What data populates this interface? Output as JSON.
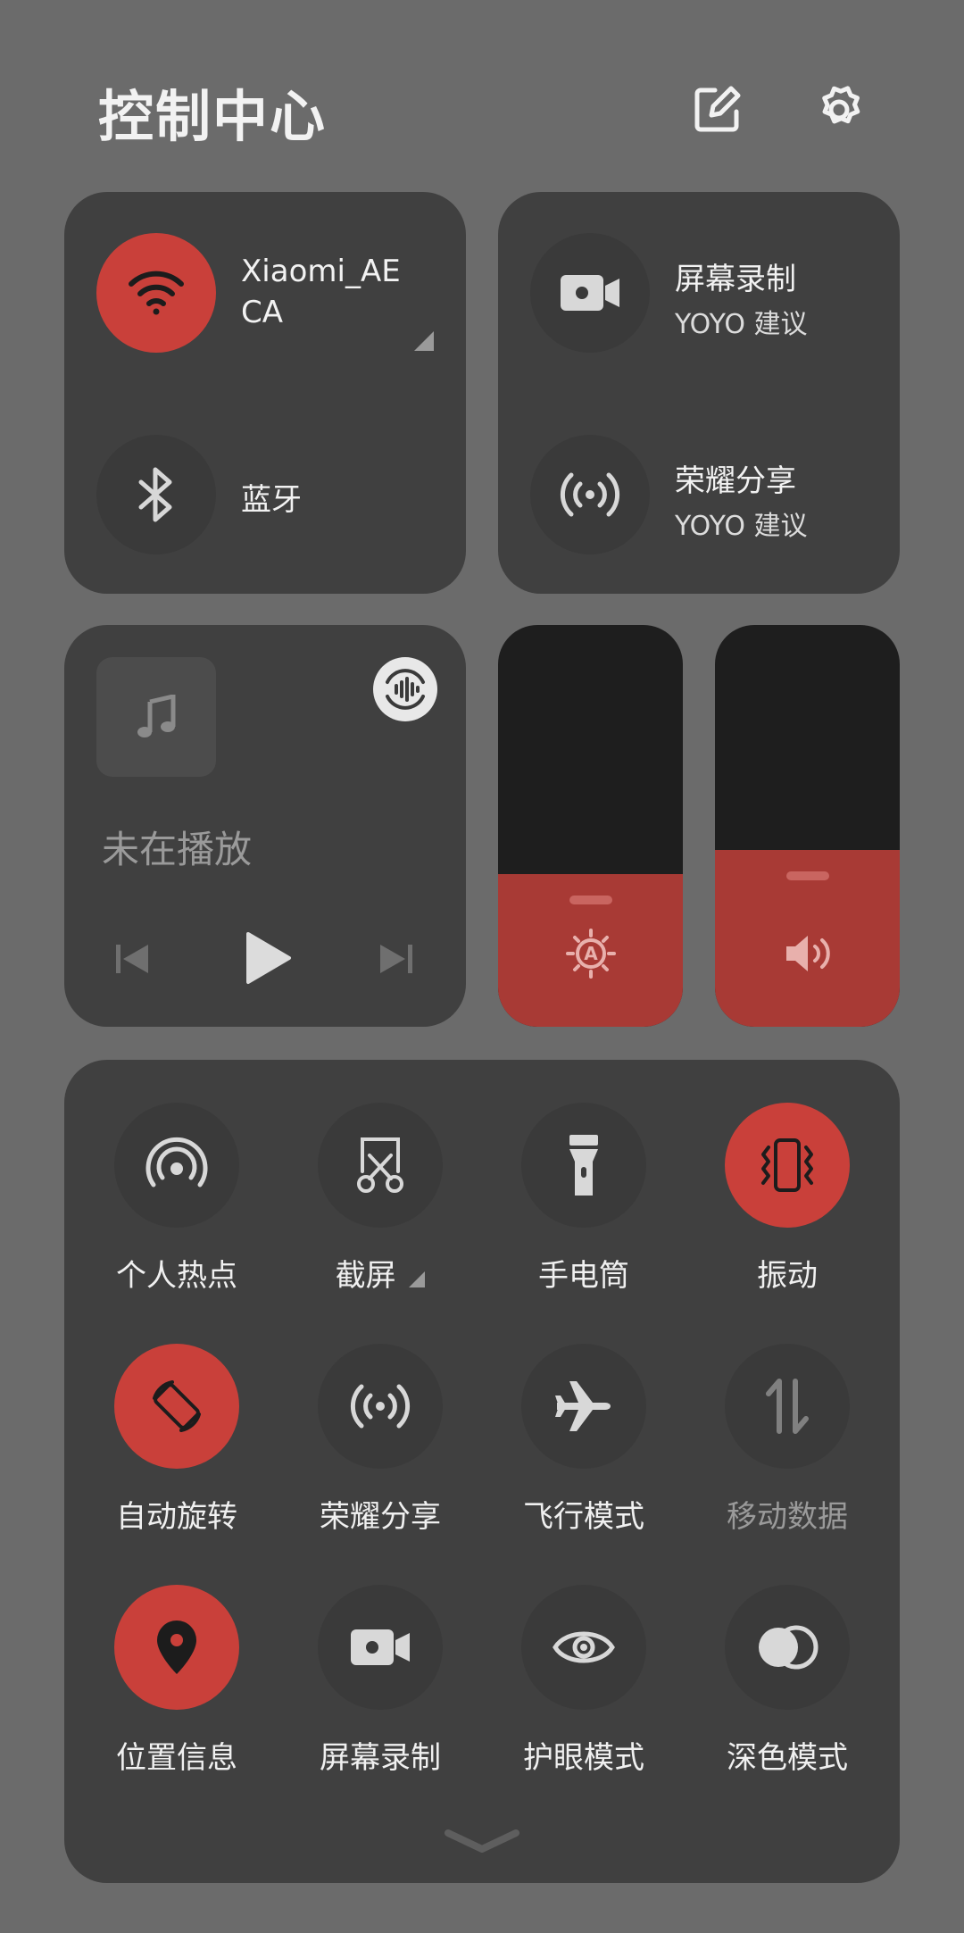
{
  "header": {
    "title": "控制中心",
    "edit_icon": "edit-icon",
    "settings_icon": "gear-icon"
  },
  "wifi": {
    "name": "Xiaomi_AECA",
    "line1": "Xiaomi_AE",
    "line2": "CA",
    "on": true,
    "icon": "wifi-icon"
  },
  "bluetooth": {
    "label": "蓝牙",
    "on": false,
    "icon": "bluetooth-icon"
  },
  "suggestions": [
    {
      "label": "屏幕录制",
      "sub": "YOYO 建议",
      "icon": "screen-record-icon"
    },
    {
      "label": "荣耀分享",
      "sub": "YOYO 建议",
      "icon": "honor-share-icon"
    }
  ],
  "media": {
    "status": "未在播放",
    "art_icon": "music-note-icon",
    "prev_icon": "previous-icon",
    "play_icon": "play-icon",
    "next_icon": "next-icon",
    "audio_icon": "audio-output-icon"
  },
  "sliders": {
    "brightness": {
      "level": 0.38,
      "icon": "auto-brightness-icon"
    },
    "volume": {
      "level": 0.44,
      "icon": "volume-icon"
    }
  },
  "toggles": [
    {
      "label": "个人热点",
      "icon": "hotspot-icon",
      "on": false
    },
    {
      "label": "截屏",
      "icon": "screenshot-icon",
      "on": false
    },
    {
      "label": "手电筒",
      "icon": "flashlight-icon",
      "on": false
    },
    {
      "label": "振动",
      "icon": "vibrate-icon",
      "on": true
    },
    {
      "label": "自动旋转",
      "icon": "auto-rotate-icon",
      "on": true
    },
    {
      "label": "荣耀分享",
      "icon": "honor-share-icon",
      "on": false
    },
    {
      "label": "飞行模式",
      "icon": "airplane-icon",
      "on": false
    },
    {
      "label": "移动数据",
      "icon": "mobile-data-icon",
      "on": false,
      "disabled": true
    },
    {
      "label": "位置信息",
      "icon": "location-icon",
      "on": true
    },
    {
      "label": "屏幕录制",
      "icon": "screen-record-icon",
      "on": false
    },
    {
      "label": "护眼模式",
      "icon": "eye-comfort-icon",
      "on": false
    },
    {
      "label": "深色模式",
      "icon": "dark-mode-icon",
      "on": false
    }
  ],
  "colors": {
    "accent": "#c9403a",
    "panel": "#404040",
    "background": "#6b6b6b"
  },
  "expand_icon": "chevron-down-icon"
}
